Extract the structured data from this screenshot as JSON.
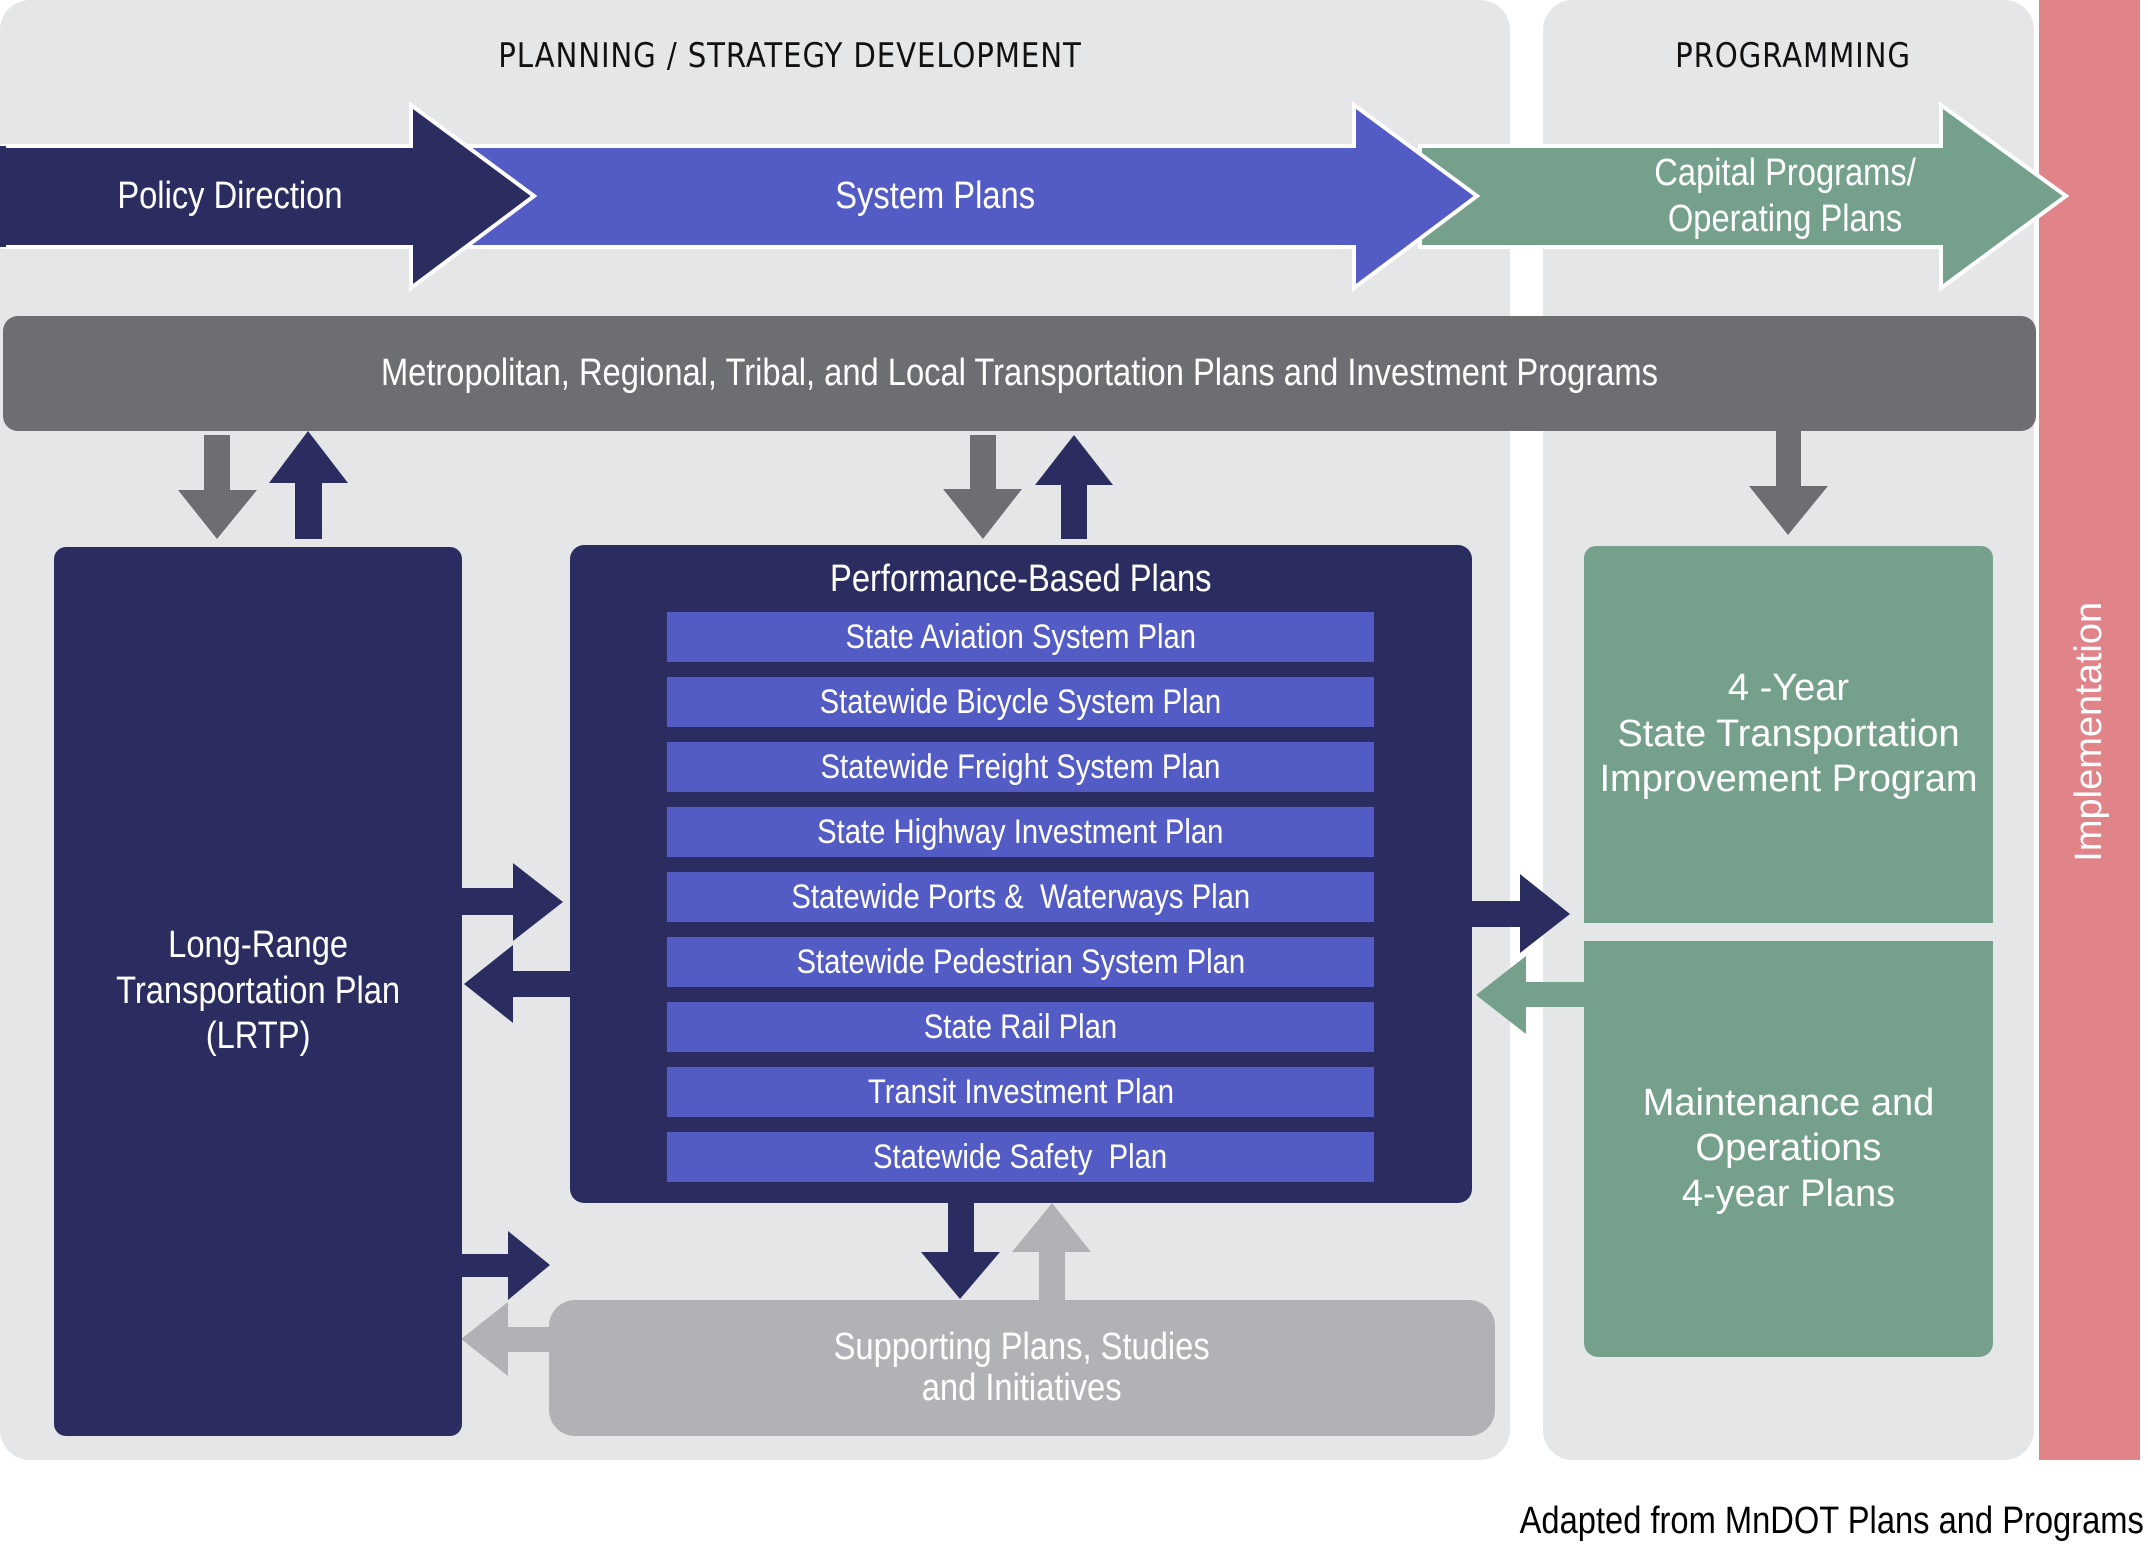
{
  "sections": {
    "planning_title": "PLANNING / STRATEGY DEVELOPMENT",
    "programming_title": "PROGRAMMING",
    "implementation_label": "Implementation"
  },
  "flow_arrows": {
    "policy_direction": "Policy Direction",
    "system_plans": "System Plans",
    "capital_programs": "Capital Programs/\nOperating Plans"
  },
  "metro_bar": {
    "label": "Metropolitan, Regional, Tribal, and Local Transportation Plans and Investment Programs"
  },
  "lrtp": {
    "label": "Long-Range\nTransportation Plan\n(LRTP)"
  },
  "performance_plans": {
    "title": "Performance-Based Plans",
    "items": [
      "State Aviation System Plan",
      "Statewide Bicycle System Plan",
      "Statewide Freight System Plan",
      "State Highway Investment Plan",
      "Statewide Ports &  Waterways Plan",
      "Statewide Pedestrian System Plan",
      "State Rail Plan",
      "Transit Investment Plan",
      "Statewide Safety  Plan"
    ]
  },
  "supporting": {
    "label": "Supporting Plans, Studies\nand Initiatives"
  },
  "stip": {
    "label": "4 -Year\nState Transportation\nImprovement Program"
  },
  "maintenance": {
    "label": "Maintenance and\nOperations\n4-year Plans"
  },
  "attribution": "Adapted from MnDOT Plans and Programs",
  "colors": {
    "panel_bg": "#e5e6e8",
    "navy": "#2b2d61",
    "blue": "#535bc4",
    "green": "#74a08c",
    "gray_dark": "#6d6e72",
    "gray_light": "#b1b2b5",
    "implementation_red": "#e0848a"
  }
}
